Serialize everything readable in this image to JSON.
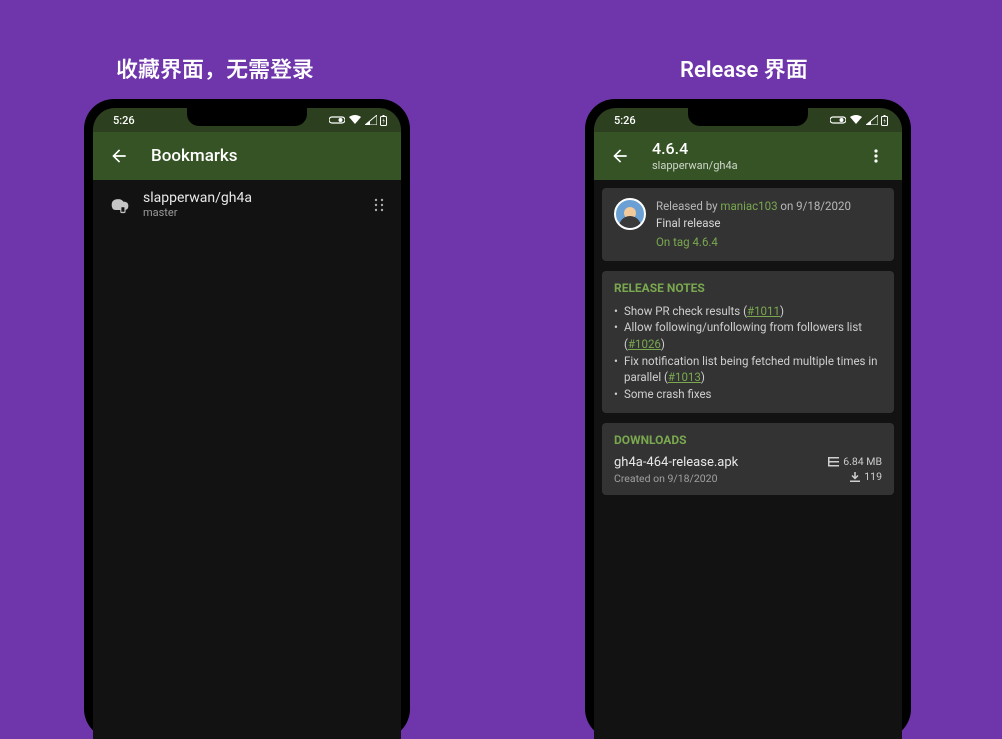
{
  "captions": {
    "left": "收藏界面，无需登录",
    "right": "Release 界面"
  },
  "status": {
    "time": "5:26"
  },
  "bookmarks": {
    "title": "Bookmarks",
    "items": [
      {
        "name": "slapperwan/gh4a",
        "branch": "master"
      }
    ]
  },
  "release": {
    "version": "4.6.4",
    "repo": "slapperwan/gh4a",
    "released_by_prefix": "Released by ",
    "released_by_author": "maniac103",
    "released_by_suffix": " on 9/18/2020",
    "final_label": "Final release",
    "tag_label": "On tag 4.6.4",
    "notes_title": "RELEASE NOTES",
    "notes": [
      {
        "pre": "Show PR check results (",
        "link": "#1011",
        "post": ")"
      },
      {
        "pre": "Allow following/unfollowing from followers list (",
        "link": "#1026",
        "post": ")"
      },
      {
        "pre": "Fix notification list being fetched multiple times in parallel (",
        "link": "#1013",
        "post": ")"
      },
      {
        "pre": "Some crash fixes",
        "link": "",
        "post": ""
      }
    ],
    "downloads_title": "DOWNLOADS",
    "download": {
      "filename": "gh4a-464-release.apk",
      "created": "Created on 9/18/2020",
      "size": "6.84 MB",
      "count": "119"
    }
  }
}
